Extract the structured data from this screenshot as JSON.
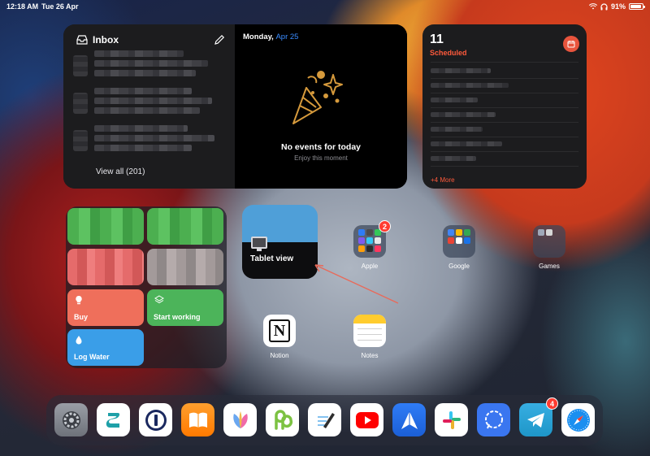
{
  "status_bar": {
    "time": "12:18 AM",
    "date": "Tue 26 Apr",
    "battery": "91%"
  },
  "mail_widget": {
    "title": "Inbox",
    "footer": "View all (201)"
  },
  "calendar_widget": {
    "weekday": "Monday,",
    "date": "Apr 25",
    "message": "No events for today",
    "subtitle": "Enjoy this moment"
  },
  "reminders_widget": {
    "count": "11",
    "title": "Scheduled",
    "more": "+4 More"
  },
  "shortcuts_widget": {
    "buttons": [
      {
        "label": "Buy",
        "icon": "lightbulb-icon",
        "color": "#ef6f5b"
      },
      {
        "label": "Start working",
        "icon": "layers-icon",
        "color": "#4cb45a"
      },
      {
        "label": "Log Water",
        "icon": "drop-icon",
        "color": "#3a9ee8"
      }
    ]
  },
  "tablet_widget": {
    "label": "Tablet view"
  },
  "apps": {
    "apple": {
      "label": "Apple",
      "badge": "2"
    },
    "google": {
      "label": "Google"
    },
    "games": {
      "label": "Games"
    },
    "notion": {
      "label": "Notion"
    },
    "notes": {
      "label": "Notes"
    }
  },
  "dock": {
    "apps": [
      "Settings",
      "Surfshark",
      "1Password",
      "Books",
      "MindNode",
      "PDF Expert",
      "GoodNotes",
      "YouTube",
      "Spark",
      "Slack",
      "Signal",
      "Telegram",
      "Safari"
    ],
    "telegram_badge": "4"
  },
  "colors": {
    "accent_red": "#ff5a3c",
    "accent_blue": "#3a8cff",
    "badge_red": "#ff3b30"
  }
}
